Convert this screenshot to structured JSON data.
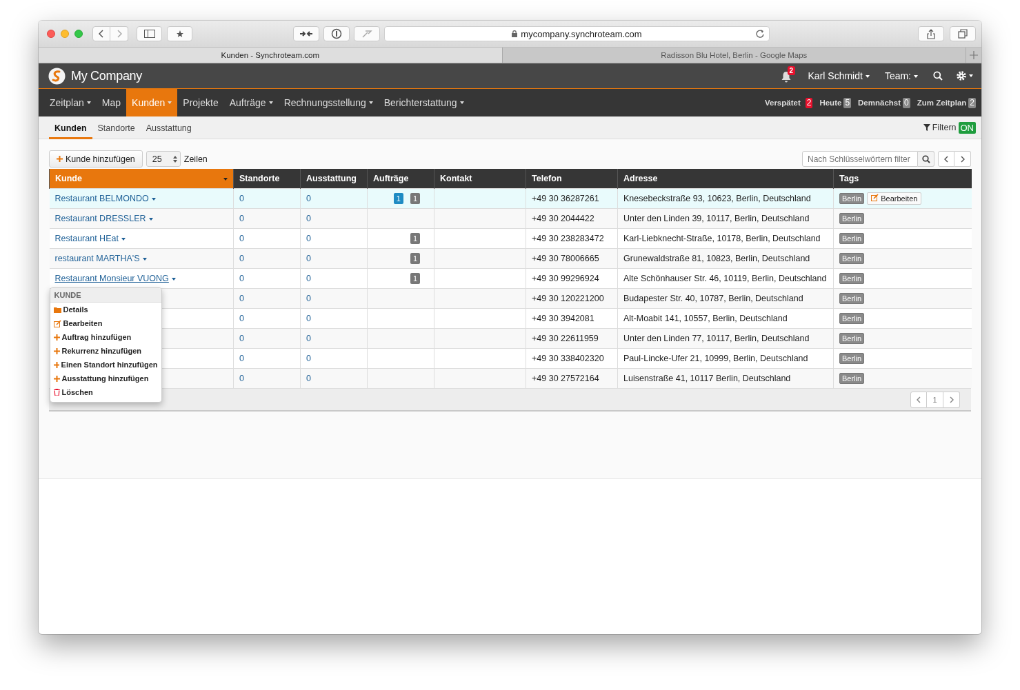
{
  "browser": {
    "url": "mycompany.synchroteam.com",
    "tabs": [
      {
        "title": "Kunden - Synchroteam.com",
        "selected": true
      },
      {
        "title": "Radisson Blu Hotel, Berlin - Google Maps",
        "selected": false
      }
    ]
  },
  "header": {
    "company": "My Company",
    "notifications": "2",
    "user": "Karl Schmidt",
    "team": "Team:"
  },
  "nav": {
    "items": [
      {
        "label": "Zeitplan",
        "dropdown": true,
        "selected": false
      },
      {
        "label": "Map",
        "dropdown": false,
        "selected": false
      },
      {
        "label": "Kunden",
        "dropdown": true,
        "selected": true
      },
      {
        "label": "Projekte",
        "dropdown": false,
        "selected": false
      },
      {
        "label": "Aufträge",
        "dropdown": true,
        "selected": false
      },
      {
        "label": "Rechnungsstellung",
        "dropdown": true,
        "selected": false
      },
      {
        "label": "Berichterstattung",
        "dropdown": true,
        "selected": false
      }
    ],
    "counters": [
      {
        "label": "Verspätet",
        "count": "2",
        "color": "#e8112d"
      },
      {
        "label": "Heute",
        "count": "5",
        "color": "#888888"
      },
      {
        "label": "Demnächst",
        "count": "0",
        "color": "#888888"
      },
      {
        "label": "Zum Zeitplan",
        "count": "2",
        "color": "#888888"
      }
    ]
  },
  "subnav": {
    "tabs": [
      {
        "label": "Kunden",
        "selected": true
      },
      {
        "label": "Standorte",
        "selected": false
      },
      {
        "label": "Ausstattung",
        "selected": false
      }
    ],
    "filter": {
      "label": "Filtern",
      "state": "ON",
      "on": true
    }
  },
  "toolbar": {
    "add_button": "Kunde hinzufügen",
    "page_size": "25",
    "page_size_label": "Zeilen",
    "search": {
      "placeholder": "Nach Schlüsselwörtern filter"
    }
  },
  "table": {
    "columns": [
      {
        "label": "Kunde",
        "sorted": true
      },
      {
        "label": "Standorte",
        "sorted": false
      },
      {
        "label": "Ausstattung",
        "sorted": false
      },
      {
        "label": "Aufträge",
        "sorted": false
      },
      {
        "label": "Kontakt",
        "sorted": false
      },
      {
        "label": "Telefon",
        "sorted": false
      },
      {
        "label": "Adresse",
        "sorted": false
      },
      {
        "label": "Tags",
        "sorted": false
      }
    ],
    "rows": [
      {
        "name": "Restaurant BELMONDO",
        "selected": true,
        "hovered": false,
        "standorte": "0",
        "ausstattung": "0",
        "orders": [
          {
            "count": "1",
            "color": "#1e8bc3"
          },
          {
            "count": "1",
            "color": "#777777"
          }
        ],
        "telefon": "+49 30 36287261",
        "adresse": "Knesebeckstraße 93, 10623, Berlin, Deutschland",
        "tags": [
          "Berlin"
        ],
        "edit_button": "Bearbeiten"
      },
      {
        "name": "Restaurant DRESSLER",
        "selected": false,
        "hovered": false,
        "standorte": "0",
        "ausstattung": "0",
        "orders": [],
        "telefon": "+49 30 2044422",
        "adresse": "Unter den Linden 39, 10117, Berlin, Deutschland",
        "tags": [
          "Berlin"
        ]
      },
      {
        "name": "Restaurant HEat",
        "selected": false,
        "hovered": false,
        "standorte": "0",
        "ausstattung": "0",
        "orders": [
          {
            "count": "1",
            "color": "#777777"
          }
        ],
        "telefon": "+49 30 238283472",
        "adresse": "Karl-Liebknecht-Straße, 10178, Berlin, Deutschland",
        "tags": [
          "Berlin"
        ]
      },
      {
        "name": "restaurant MARTHA'S",
        "selected": false,
        "hovered": false,
        "standorte": "0",
        "ausstattung": "0",
        "orders": [
          {
            "count": "1",
            "color": "#777777"
          }
        ],
        "telefon": "+49 30 78006665",
        "adresse": "Grunewaldstraße 81, 10823, Berlin, Deutschland",
        "tags": [
          "Berlin"
        ]
      },
      {
        "name": "Restaurant Monsieur VUONG",
        "selected": false,
        "hovered": true,
        "standorte": "0",
        "ausstattung": "0",
        "orders": [
          {
            "count": "1",
            "color": "#777777"
          }
        ],
        "telefon": "+49 30 99296924",
        "adresse": "Alte Schönhauser Str. 46, 10119, Berlin, Deutschland",
        "tags": [
          "Berlin"
        ]
      },
      {
        "selected": false,
        "standorte": "0",
        "ausstattung": "0",
        "orders": [],
        "telefon": "+49 30 120221200",
        "adresse": "Budapester Str. 40, 10787, Berlin, Deutschland",
        "tags": [
          "Berlin"
        ]
      },
      {
        "selected": false,
        "standorte": "0",
        "ausstattung": "0",
        "orders": [],
        "telefon": "+49 30 3942081",
        "adresse": "Alt-Moabit 141, 10557, Berlin, Deutschland",
        "tags": [
          "Berlin"
        ]
      },
      {
        "selected": false,
        "standorte": "0",
        "ausstattung": "0",
        "orders": [],
        "telefon": "+49 30 22611959",
        "adresse": "Unter den Linden 77, 10117, Berlin, Deutschland",
        "tags": [
          "Berlin"
        ]
      },
      {
        "selected": false,
        "standorte": "0",
        "ausstattung": "0",
        "orders": [],
        "telefon": "+49 30 338402320",
        "adresse": "Paul-Lincke-Ufer 21, 10999, Berlin, Deutschland",
        "tags": [
          "Berlin"
        ]
      },
      {
        "selected": false,
        "standorte": "0",
        "ausstattung": "0",
        "orders": [],
        "telefon": "+49 30 27572164",
        "adresse": "Luisenstraße 41, 10117 Berlin, Deutschland",
        "tags": [
          "Berlin"
        ]
      }
    ]
  },
  "row_menu": {
    "header": "KUNDE",
    "items": [
      {
        "label": "Details",
        "kind": "folder"
      },
      {
        "label": "Bearbeiten",
        "kind": "edit"
      },
      {
        "label": "Auftrag hinzufügen",
        "kind": "add"
      },
      {
        "label": "Rekurrenz hinzufügen",
        "kind": "add"
      },
      {
        "label": "Einen Standort hinzufügen",
        "kind": "add"
      },
      {
        "label": "Ausstattung hinzufügen",
        "kind": "add"
      },
      {
        "label": "Löschen",
        "kind": "delete"
      }
    ]
  },
  "pagination": {
    "page": "1"
  }
}
